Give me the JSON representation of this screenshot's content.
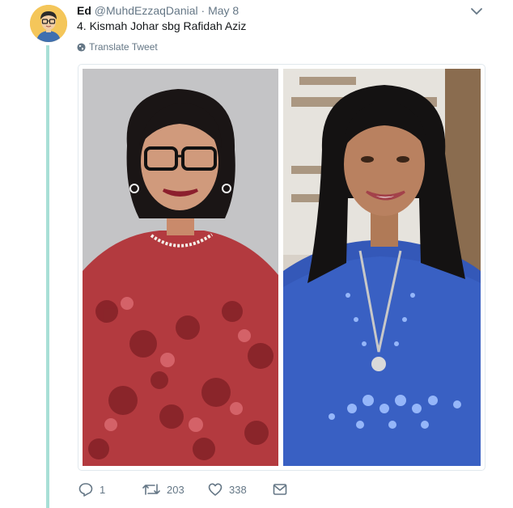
{
  "tweet": {
    "author_name": "Ed",
    "author_handle": "@MuhdEzzaqDanial",
    "separator": "·",
    "date": "May 8",
    "text": "4. Kismah Johar sbg Rafidah Aziz",
    "translate_label": "Translate Tweet",
    "avatar_icon": "cartoon-avatar-icon",
    "menu_icon": "chevron-down-icon"
  },
  "media": {
    "left_photo": "woman-red-floral-dress-photo",
    "right_photo": "woman-blue-embellished-top-photo"
  },
  "actions": {
    "reply_count": "1",
    "retweet_count": "203",
    "like_count": "338",
    "reply_icon": "reply-icon",
    "retweet_icon": "retweet-icon",
    "like_icon": "heart-icon",
    "dm_icon": "envelope-icon"
  },
  "colors": {
    "thread_line": "#a8dfd6",
    "secondary_text": "#657786",
    "avatar_bg": "#f4c65a"
  }
}
